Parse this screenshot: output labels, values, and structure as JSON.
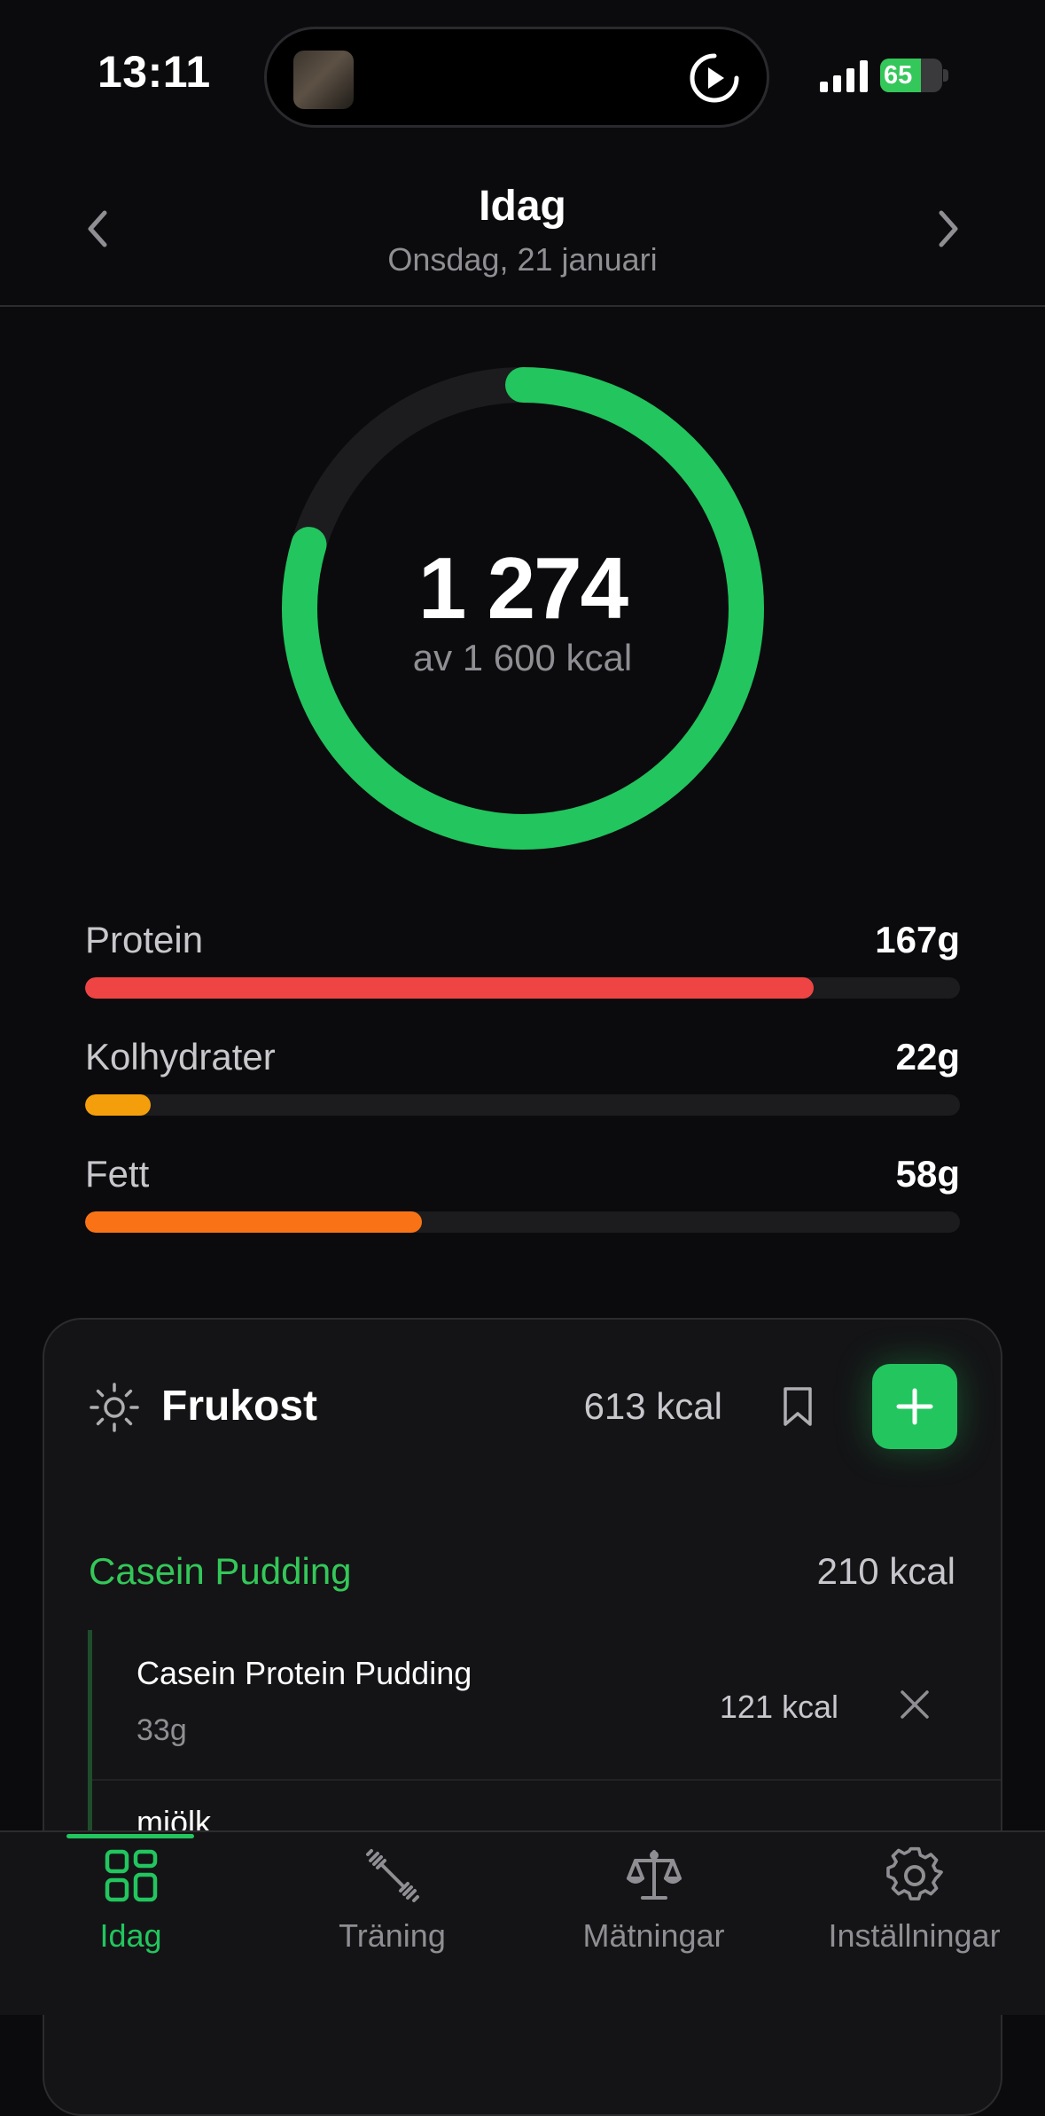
{
  "status_bar": {
    "time": "13:11",
    "battery_percent": "65",
    "battery_level": 0.65,
    "battery_color": "#34c759"
  },
  "header": {
    "title": "Idag",
    "date": "Onsdag, 21 januari",
    "prev_icon": "chevron-left-icon",
    "next_icon": "chevron-right-icon"
  },
  "calories": {
    "eaten": "1 274",
    "goal_text": "av 1 600 kcal",
    "progress": 0.796,
    "ring_color": "#22c55e"
  },
  "macros": [
    {
      "name": "Protein",
      "value": "167g",
      "progress": 0.833,
      "color": "#ef4444"
    },
    {
      "name": "Kolhydrater",
      "value": "22g",
      "progress": 0.075,
      "color": "#f59e0b"
    },
    {
      "name": "Fett",
      "value": "58g",
      "progress": 0.385,
      "color": "#f97316"
    }
  ],
  "meal": {
    "title": "Frukost",
    "kcal": "613 kcal",
    "icon": "sun-icon",
    "recipe": {
      "name": "Casein Pudding",
      "kcal": "210 kcal",
      "ingredients": [
        {
          "name": "Casein Protein Pudding",
          "amount": "33g",
          "kcal": "121 kcal"
        },
        {
          "name": "mjölk"
        }
      ]
    }
  },
  "tabs": [
    {
      "label": "Idag",
      "icon": "grid-icon",
      "active": true
    },
    {
      "label": "Träning",
      "icon": "dumbbell-icon",
      "active": false
    },
    {
      "label": "Mätningar",
      "icon": "scale-icon",
      "active": false
    },
    {
      "label": "Inställningar",
      "icon": "gear-icon",
      "active": false
    }
  ],
  "accent_color": "#22c55e"
}
